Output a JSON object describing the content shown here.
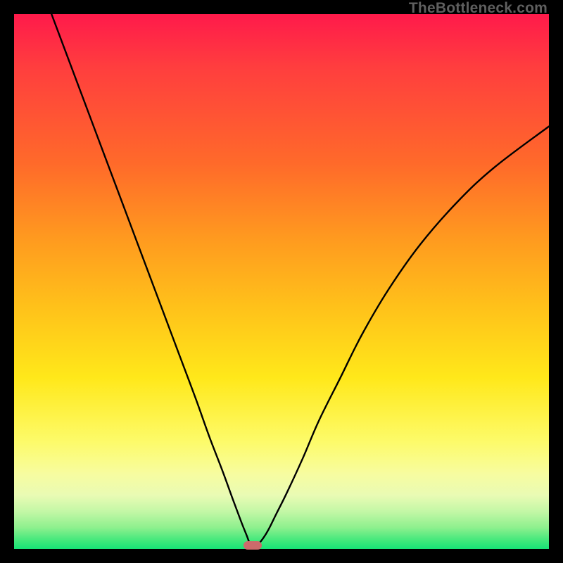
{
  "watermark": "TheBottleneck.com",
  "chart_data": {
    "type": "line",
    "title": "",
    "xlabel": "",
    "ylabel": "",
    "xlim": [
      0,
      100
    ],
    "ylim": [
      0,
      100
    ],
    "series": [
      {
        "name": "bottleneck-curve",
        "x": [
          7,
          10,
          13,
          16,
          19,
          22,
          25,
          28,
          31,
          34,
          36.5,
          39,
          41,
          42.5,
          43.5,
          44,
          44.5,
          45.2,
          46.2,
          47.5,
          49,
          51,
          54,
          57,
          61,
          65,
          70,
          76,
          83,
          90,
          100
        ],
        "y": [
          100,
          92,
          84,
          76,
          68,
          60,
          52,
          44,
          36,
          28,
          21,
          14.5,
          9,
          5,
          2.5,
          1.2,
          0.6,
          0.6,
          1.5,
          3.5,
          6.5,
          10.5,
          17,
          24,
          32,
          40,
          48.5,
          57,
          65,
          71.5,
          79
        ]
      }
    ],
    "marker": {
      "x": 44.6,
      "y": 0.6
    },
    "background_gradient": {
      "top": "#ff1a4b",
      "mid": "#ffe81a",
      "bottom": "#17e376"
    }
  }
}
